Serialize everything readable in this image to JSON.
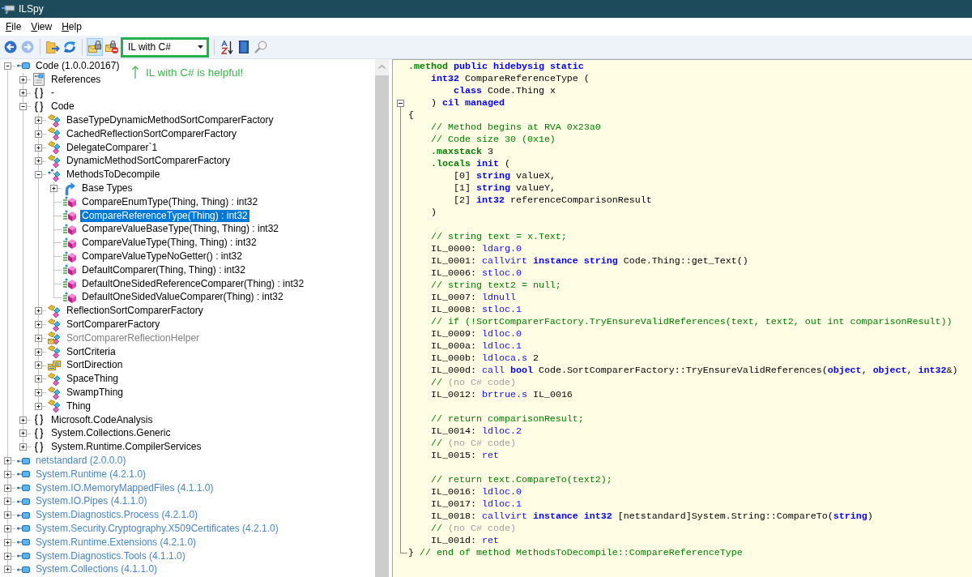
{
  "window": {
    "title": "ILSpy"
  },
  "menu": [
    {
      "label": "File"
    },
    {
      "label": "View"
    },
    {
      "label": "Help"
    }
  ],
  "toolbar": {
    "items": [
      {
        "kind": "back",
        "disabled": false,
        "pressed": false
      },
      {
        "kind": "forward",
        "disabled": true,
        "pressed": false
      },
      {
        "kind": "separator"
      },
      {
        "kind": "open",
        "disabled": false,
        "pressed": false
      },
      {
        "kind": "reload",
        "disabled": false,
        "pressed": false
      },
      {
        "kind": "separator"
      },
      {
        "kind": "lock",
        "disabled": false,
        "pressed": true
      },
      {
        "kind": "lock-minus",
        "disabled": false,
        "pressed": false
      },
      {
        "kind": "language",
        "value": "IL with C#",
        "highlighted": true
      },
      {
        "kind": "separator"
      },
      {
        "kind": "sort",
        "disabled": false,
        "pressed": false
      },
      {
        "kind": "book",
        "disabled": false,
        "pressed": false
      },
      {
        "kind": "search",
        "disabled": false,
        "pressed": false
      }
    ]
  },
  "annotation": {
    "text": "IL with C# is helpful!"
  },
  "tree": {
    "nodes": [
      {
        "label": "Code (1.0.0.20167)",
        "kind": "assembly",
        "auto_loaded": false,
        "expanded": true,
        "selected": false,
        "children": [
          {
            "label": "References",
            "kind": "references",
            "expanded": false,
            "selected": false
          },
          {
            "label": "-",
            "kind": "namespace",
            "expanded": false,
            "selected": false
          },
          {
            "label": "Code",
            "kind": "namespace",
            "expanded": true,
            "selected": false,
            "children": [
              {
                "label": "BaseTypeDynamicMethodSortComparerFactory",
                "kind": "class",
                "expanded": false,
                "selected": false
              },
              {
                "label": "CachedReflectionSortComparerFactory",
                "kind": "class",
                "expanded": false,
                "selected": false
              },
              {
                "label": "DelegateComparer`1",
                "kind": "class",
                "expanded": false,
                "selected": false
              },
              {
                "label": "DynamicMethodSortComparerFactory",
                "kind": "class",
                "expanded": false,
                "selected": false
              },
              {
                "label": "MethodsToDecompile",
                "kind": "static-class",
                "expanded": true,
                "selected": false,
                "children": [
                  {
                    "label": "Base Types",
                    "kind": "base-types",
                    "expanded": false,
                    "selected": false
                  },
                  {
                    "label": "CompareEnumType(Thing, Thing) : int32",
                    "kind": "method",
                    "selected": false
                  },
                  {
                    "label": "CompareReferenceType(Thing) : int32",
                    "kind": "method",
                    "selected": true
                  },
                  {
                    "label": "CompareValueBaseType(Thing, Thing) : int32",
                    "kind": "method",
                    "selected": false
                  },
                  {
                    "label": "CompareValueType(Thing, Thing) : int32",
                    "kind": "method",
                    "selected": false
                  },
                  {
                    "label": "CompareValueTypeNoGetter() : int32",
                    "kind": "method",
                    "selected": false
                  },
                  {
                    "label": "DefaultComparer(Thing, Thing) : int32",
                    "kind": "method",
                    "selected": false
                  },
                  {
                    "label": "DefaultOneSidedReferenceComparer(Thing) : int32",
                    "kind": "method",
                    "selected": false
                  },
                  {
                    "label": "DefaultOneSidedValueComparer(Thing) : int32",
                    "kind": "method",
                    "selected": false
                  }
                ]
              },
              {
                "label": "ReflectionSortComparerFactory",
                "kind": "class",
                "expanded": false,
                "selected": false
              },
              {
                "label": "SortComparerFactory",
                "kind": "class",
                "expanded": false,
                "selected": false
              },
              {
                "label": "SortComparerReflectionHelper",
                "kind": "internal-class",
                "expanded": false,
                "selected": false
              },
              {
                "label": "SortCriteria",
                "kind": "class",
                "expanded": false,
                "selected": false
              },
              {
                "label": "SortDirection",
                "kind": "enum",
                "expanded": false,
                "selected": false
              },
              {
                "label": "SpaceThing",
                "kind": "class",
                "expanded": false,
                "selected": false
              },
              {
                "label": "SwampThing",
                "kind": "class",
                "expanded": false,
                "selected": false
              },
              {
                "label": "Thing",
                "kind": "class",
                "expanded": false,
                "selected": false
              }
            ]
          },
          {
            "label": "Microsoft.CodeAnalysis",
            "kind": "namespace",
            "expanded": false,
            "selected": false
          },
          {
            "label": "System.Collections.Generic",
            "kind": "namespace",
            "expanded": false,
            "selected": false
          },
          {
            "label": "System.Runtime.CompilerServices",
            "kind": "namespace",
            "expanded": false,
            "selected": false
          }
        ]
      },
      {
        "label": "netstandard (2.0.0.0)",
        "kind": "assembly",
        "auto_loaded": true,
        "expanded": false,
        "selected": false
      },
      {
        "label": "System.Runtime (4.2.1.0)",
        "kind": "assembly",
        "auto_loaded": true,
        "expanded": false,
        "selected": false
      },
      {
        "label": "System.IO.MemoryMappedFiles (4.1.1.0)",
        "kind": "assembly",
        "auto_loaded": true,
        "expanded": false,
        "selected": false
      },
      {
        "label": "System.IO.Pipes (4.1.1.0)",
        "kind": "assembly",
        "auto_loaded": true,
        "expanded": false,
        "selected": false
      },
      {
        "label": "System.Diagnostics.Process (4.2.1.0)",
        "kind": "assembly",
        "auto_loaded": true,
        "expanded": false,
        "selected": false
      },
      {
        "label": "System.Security.Cryptography.X509Certificates (4.2.1.0)",
        "kind": "assembly",
        "auto_loaded": true,
        "expanded": false,
        "selected": false
      },
      {
        "label": "System.Runtime.Extensions (4.2.1.0)",
        "kind": "assembly",
        "auto_loaded": true,
        "expanded": false,
        "selected": false
      },
      {
        "label": "System.Diagnostics.Tools (4.1.1.0)",
        "kind": "assembly",
        "auto_loaded": true,
        "expanded": false,
        "selected": false
      },
      {
        "label": "System.Collections (4.1.1.0)",
        "kind": "assembly",
        "auto_loaded": true,
        "expanded": false,
        "selected": false
      }
    ]
  },
  "code": {
    "lines": [
      {
        "tokens": [
          {
            "kind": "directive",
            "text": ".method"
          },
          {
            "kind": "keyword",
            "text": " public hidebysig static"
          }
        ]
      },
      {
        "tokens": [
          {
            "kind": "keyword",
            "text": "    int32"
          },
          {
            "kind": "plain",
            "text": " CompareReferenceType ("
          }
        ]
      },
      {
        "tokens": [
          {
            "kind": "keyword",
            "text": "        class"
          },
          {
            "kind": "plain",
            "text": " Code.Thing x"
          }
        ]
      },
      {
        "fold_start": true,
        "tokens": [
          {
            "kind": "plain",
            "text": "    ) "
          },
          {
            "kind": "keyword",
            "text": "cil managed"
          }
        ]
      },
      {
        "tokens": [
          {
            "kind": "plain",
            "text": "{"
          }
        ]
      },
      {
        "tokens": [
          {
            "kind": "comment",
            "text": "    // Method begins at RVA 0x23a0"
          }
        ]
      },
      {
        "tokens": [
          {
            "kind": "comment",
            "text": "    // Code size 30 (0x1e)"
          }
        ]
      },
      {
        "tokens": [
          {
            "kind": "directive",
            "text": "    .maxstack"
          },
          {
            "kind": "plain",
            "text": " 3"
          }
        ]
      },
      {
        "tokens": [
          {
            "kind": "directive",
            "text": "    .locals"
          },
          {
            "kind": "keyword",
            "text": " init"
          },
          {
            "kind": "plain",
            "text": " ("
          }
        ]
      },
      {
        "tokens": [
          {
            "kind": "plain",
            "text": "        [0] "
          },
          {
            "kind": "keyword",
            "text": "string"
          },
          {
            "kind": "plain",
            "text": " valueX,"
          }
        ]
      },
      {
        "tokens": [
          {
            "kind": "plain",
            "text": "        [1] "
          },
          {
            "kind": "keyword",
            "text": "string"
          },
          {
            "kind": "plain",
            "text": " valueY,"
          }
        ]
      },
      {
        "tokens": [
          {
            "kind": "plain",
            "text": "        [2] "
          },
          {
            "kind": "keyword",
            "text": "int32"
          },
          {
            "kind": "plain",
            "text": " referenceComparisonResult"
          }
        ]
      },
      {
        "tokens": [
          {
            "kind": "plain",
            "text": "    )"
          }
        ]
      },
      {
        "space_before": true,
        "tokens": [
          {
            "kind": "comment",
            "text": "    // string text = x.Text;"
          }
        ]
      },
      {
        "tokens": [
          {
            "kind": "plain",
            "text": "    IL_0000: "
          },
          {
            "kind": "opcode",
            "text": "ldarg.0"
          }
        ]
      },
      {
        "tokens": [
          {
            "kind": "plain",
            "text": "    IL_0001: "
          },
          {
            "kind": "opcode",
            "text": "callvirt"
          },
          {
            "kind": "keyword",
            "text": " instance string"
          },
          {
            "kind": "plain",
            "text": " Code.Thing::get_Text()"
          }
        ]
      },
      {
        "tokens": [
          {
            "kind": "plain",
            "text": "    IL_0006: "
          },
          {
            "kind": "opcode",
            "text": "stloc.0"
          }
        ]
      },
      {
        "tokens": [
          {
            "kind": "comment",
            "text": "    // string text2 = null;"
          }
        ]
      },
      {
        "tokens": [
          {
            "kind": "plain",
            "text": "    IL_0007: "
          },
          {
            "kind": "opcode",
            "text": "ldnull"
          }
        ]
      },
      {
        "tokens": [
          {
            "kind": "plain",
            "text": "    IL_0008: "
          },
          {
            "kind": "opcode",
            "text": "stloc.1"
          }
        ]
      },
      {
        "tokens": [
          {
            "kind": "comment",
            "text": "    // if (!SortComparerFactory.TryEnsureValidReferences(text, text2, out int comparisonResult))"
          }
        ]
      },
      {
        "tokens": [
          {
            "kind": "plain",
            "text": "    IL_0009: "
          },
          {
            "kind": "opcode",
            "text": "ldloc.0"
          }
        ]
      },
      {
        "tokens": [
          {
            "kind": "plain",
            "text": "    IL_000a: "
          },
          {
            "kind": "opcode",
            "text": "ldloc.1"
          }
        ]
      },
      {
        "tokens": [
          {
            "kind": "plain",
            "text": "    IL_000b: "
          },
          {
            "kind": "opcode",
            "text": "ldloca.s"
          },
          {
            "kind": "plain",
            "text": " 2"
          }
        ]
      },
      {
        "tokens": [
          {
            "kind": "plain",
            "text": "    IL_000d: "
          },
          {
            "kind": "opcode",
            "text": "call"
          },
          {
            "kind": "keyword",
            "text": " bool"
          },
          {
            "kind": "plain",
            "text": " Code.SortComparerFactory::TryEnsureValidReferences("
          },
          {
            "kind": "keyword",
            "text": "object"
          },
          {
            "kind": "plain",
            "text": ", "
          },
          {
            "kind": "keyword",
            "text": "object"
          },
          {
            "kind": "plain",
            "text": ", "
          },
          {
            "kind": "keyword",
            "text": "int32"
          },
          {
            "kind": "plain",
            "text": "&)"
          }
        ]
      },
      {
        "tokens": [
          {
            "kind": "comment",
            "text": "    //"
          },
          {
            "kind": "muted",
            "text": " (no C# code)"
          }
        ]
      },
      {
        "tokens": [
          {
            "kind": "plain",
            "text": "    IL_0012: "
          },
          {
            "kind": "opcode",
            "text": "brtrue.s"
          },
          {
            "kind": "plain",
            "text": " IL_0016"
          }
        ]
      },
      {
        "space_before": true,
        "tokens": [
          {
            "kind": "comment",
            "text": "    // return comparisonResult;"
          }
        ]
      },
      {
        "tokens": [
          {
            "kind": "plain",
            "text": "    IL_0014: "
          },
          {
            "kind": "opcode",
            "text": "ldloc.2"
          }
        ]
      },
      {
        "tokens": [
          {
            "kind": "comment",
            "text": "    //"
          },
          {
            "kind": "muted",
            "text": " (no C# code)"
          }
        ]
      },
      {
        "tokens": [
          {
            "kind": "plain",
            "text": "    IL_0015: "
          },
          {
            "kind": "opcode",
            "text": "ret"
          }
        ]
      },
      {
        "space_before": true,
        "tokens": [
          {
            "kind": "comment",
            "text": "    // return text.CompareTo(text2);"
          }
        ]
      },
      {
        "tokens": [
          {
            "kind": "plain",
            "text": "    IL_0016: "
          },
          {
            "kind": "opcode",
            "text": "ldloc.0"
          }
        ]
      },
      {
        "tokens": [
          {
            "kind": "plain",
            "text": "    IL_0017: "
          },
          {
            "kind": "opcode",
            "text": "ldloc.1"
          }
        ]
      },
      {
        "tokens": [
          {
            "kind": "plain",
            "text": "    IL_0018: "
          },
          {
            "kind": "opcode",
            "text": "callvirt"
          },
          {
            "kind": "keyword",
            "text": " instance int32"
          },
          {
            "kind": "plain",
            "text": " [netstandard]System.String::CompareTo("
          },
          {
            "kind": "keyword",
            "text": "string"
          },
          {
            "kind": "plain",
            "text": ")"
          }
        ]
      },
      {
        "tokens": [
          {
            "kind": "comment",
            "text": "    //"
          },
          {
            "kind": "muted",
            "text": " (no C# code)"
          }
        ]
      },
      {
        "tokens": [
          {
            "kind": "plain",
            "text": "    IL_001d: "
          },
          {
            "kind": "opcode",
            "text": "ret"
          }
        ]
      },
      {
        "fold_end": true,
        "tokens": [
          {
            "kind": "plain",
            "text": "} "
          },
          {
            "kind": "comment",
            "text": "// end of method MethodsToDecompile::CompareReferenceType"
          }
        ]
      }
    ]
  }
}
